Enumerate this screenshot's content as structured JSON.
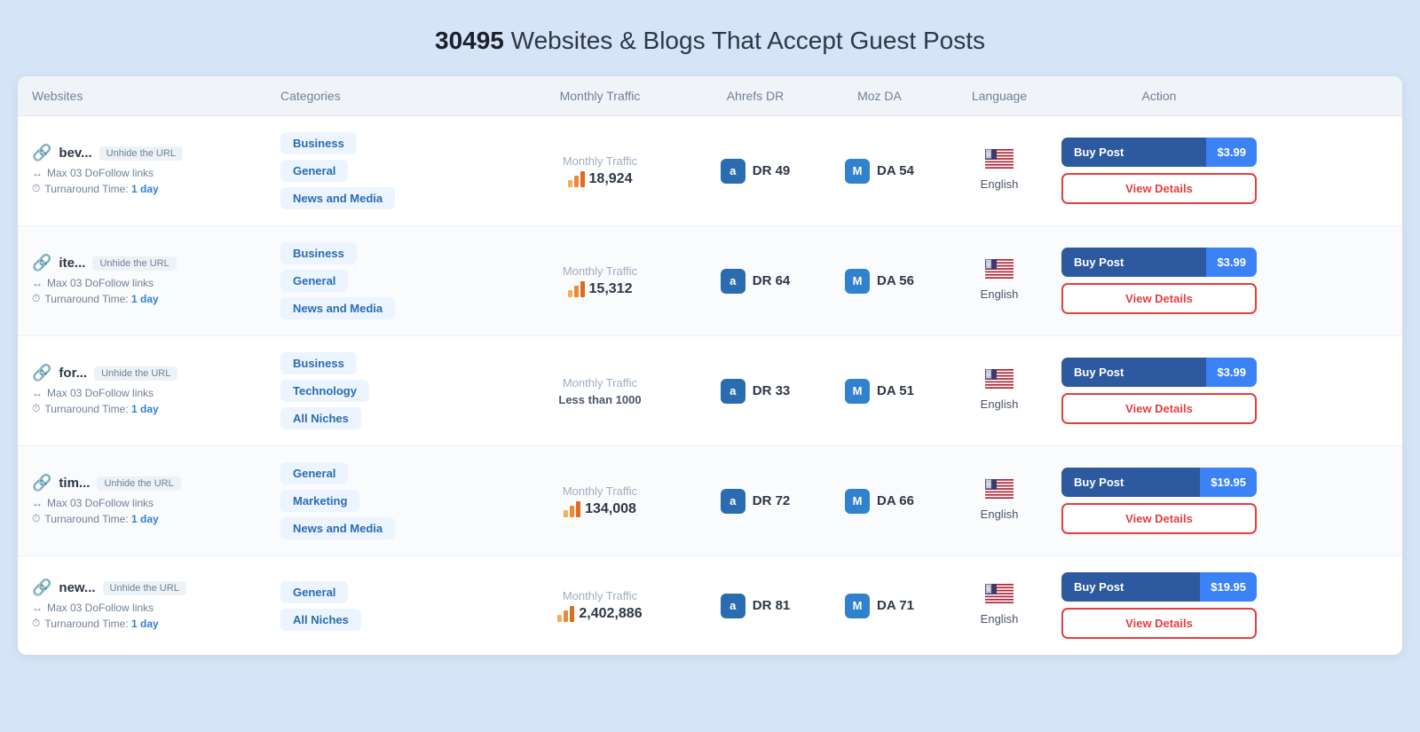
{
  "header": {
    "count": "30495",
    "subtitle": " Websites & Blogs That Accept Guest Posts"
  },
  "columns": {
    "websites": "Websites",
    "categories": "Categories",
    "monthly_traffic": "Monthly Traffic",
    "ahrefs_dr": "Ahrefs DR",
    "moz_da": "Moz DA",
    "language": "Language",
    "action": "Action"
  },
  "rows": [
    {
      "name": "bev...",
      "unhide": "Unhide the URL",
      "dofollow": "Max 03 DoFollow links",
      "turnaround": "Turnaround Time:",
      "turnaround_value": "1 day",
      "categories": [
        "Business",
        "General",
        "News and Media"
      ],
      "traffic_label": "Monthly Traffic",
      "traffic_value": "18,924",
      "traffic_less": false,
      "dr": "49",
      "da": "54",
      "language": "English",
      "price": "$3.99"
    },
    {
      "name": "ite...",
      "unhide": "Unhide the URL",
      "dofollow": "Max 03 DoFollow links",
      "turnaround": "Turnaround Time:",
      "turnaround_value": "1 day",
      "categories": [
        "Business",
        "General",
        "News and Media"
      ],
      "traffic_label": "Monthly Traffic",
      "traffic_value": "15,312",
      "traffic_less": false,
      "dr": "64",
      "da": "56",
      "language": "English",
      "price": "$3.99"
    },
    {
      "name": "for...",
      "unhide": "Unhide the URL",
      "dofollow": "Max 03 DoFollow links",
      "turnaround": "Turnaround Time:",
      "turnaround_value": "1 day",
      "categories": [
        "Business",
        "Technology",
        "All Niches"
      ],
      "traffic_label": "Monthly Traffic",
      "traffic_value": "Less than 1000",
      "traffic_less": true,
      "dr": "33",
      "da": "51",
      "language": "English",
      "price": "$3.99"
    },
    {
      "name": "tim...",
      "unhide": "Unhide the URL",
      "dofollow": "Max 03 DoFollow links",
      "turnaround": "Turnaround Time:",
      "turnaround_value": "1 day",
      "categories": [
        "General",
        "Marketing",
        "News and Media"
      ],
      "traffic_label": "Monthly Traffic",
      "traffic_value": "134,008",
      "traffic_less": false,
      "dr": "72",
      "da": "66",
      "language": "English",
      "price": "$19.95"
    },
    {
      "name": "new...",
      "unhide": "Unhide the URL",
      "dofollow": "Max 03 DoFollow links",
      "turnaround": "Turnaround Time:",
      "turnaround_value": "1 day",
      "categories": [
        "General",
        "All Niches"
      ],
      "traffic_label": "Monthly Traffic",
      "traffic_value": "2,402,886",
      "traffic_less": false,
      "dr": "81",
      "da": "71",
      "language": "English",
      "price": "$19.95"
    }
  ],
  "buttons": {
    "buy_post": "Buy Post",
    "view_details": "View Details"
  }
}
